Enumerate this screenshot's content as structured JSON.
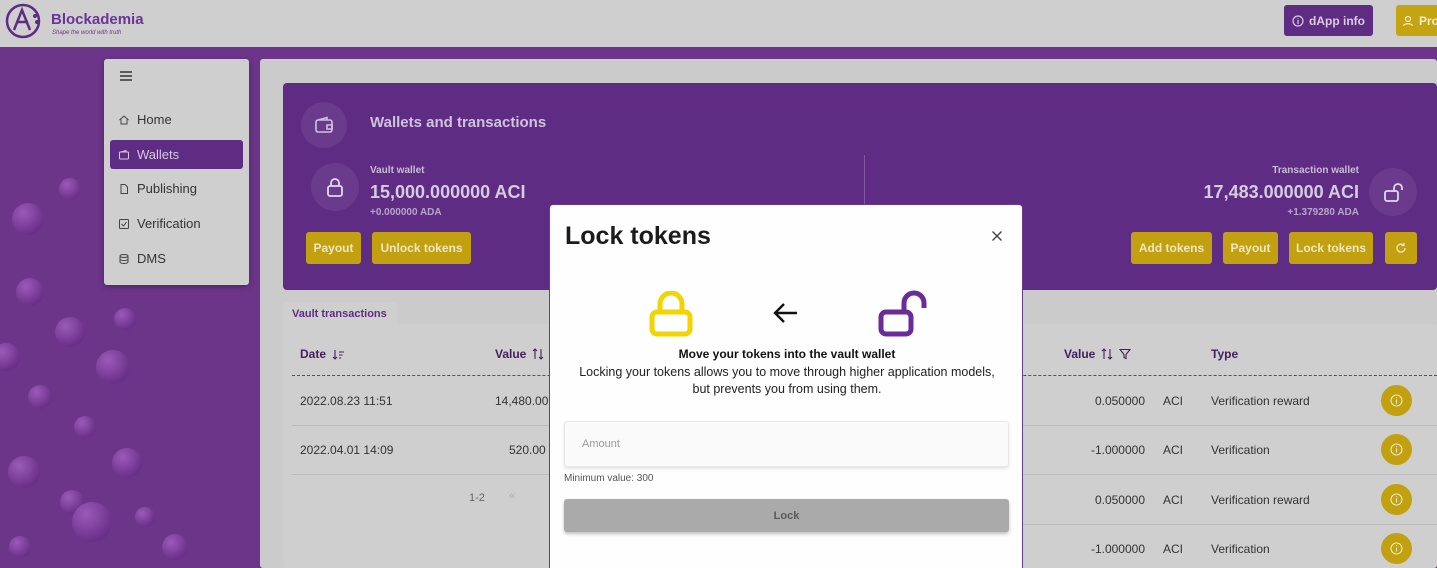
{
  "header": {
    "brand": "Blockademia",
    "tagline": "Shape the world with truth",
    "dapp_info_label": "dApp info",
    "profile_label": "Pro"
  },
  "sidebar": {
    "items": [
      {
        "label": "Home",
        "icon": "home-icon"
      },
      {
        "label": "Wallets",
        "icon": "wallet-icon",
        "active": true
      },
      {
        "label": "Publishing",
        "icon": "document-icon"
      },
      {
        "label": "Verification",
        "icon": "checkbox-icon"
      },
      {
        "label": "DMS",
        "icon": "database-icon"
      }
    ]
  },
  "wallets": {
    "title": "Wallets and transactions",
    "vault": {
      "label": "Vault wallet",
      "value": "15,000.000000 ACI",
      "ada": "+0.000000 ADA",
      "buttons": [
        "Payout",
        "Unlock tokens"
      ]
    },
    "transaction": {
      "label": "Transaction wallet",
      "value": "17,483.000000 ACI",
      "ada": "+1.379280 ADA",
      "buttons": [
        "Add tokens",
        "Payout",
        "Lock tokens"
      ]
    }
  },
  "vault_table": {
    "tab": "Vault transactions",
    "headers": {
      "date": "Date",
      "value": "Value"
    },
    "rows": [
      {
        "date": "2022.08.23 11:51",
        "value": "14,480.00"
      },
      {
        "date": "2022.04.01 14:09",
        "value": "520.00"
      }
    ],
    "pager": {
      "range": "1-2",
      "first": "«"
    }
  },
  "tx_table": {
    "headers": {
      "value": "Value",
      "type": "Type"
    },
    "rows": [
      {
        "value": "0.050000",
        "unit": "ACI",
        "type": "Verification reward"
      },
      {
        "value": "-1.000000",
        "unit": "ACI",
        "type": "Verification"
      },
      {
        "value": "0.050000",
        "unit": "ACI",
        "type": "Verification reward"
      },
      {
        "value": "-1.000000",
        "unit": "ACI",
        "type": "Verification"
      }
    ]
  },
  "modal": {
    "title": "Lock tokens",
    "heading": "Move your tokens into the vault wallet",
    "description_line1": "Locking your tokens allows you to move through higher application models,",
    "description_line2": "but prevents you from using them.",
    "amount_placeholder": "Amount",
    "amount_value": "",
    "min_value_text": "Minimum value: 300",
    "lock_button": "Lock"
  },
  "colors": {
    "primary_purple": "#5e2c82",
    "accent_yellow": "#c1a10f",
    "modal_yellow": "#f2d400",
    "modal_purple": "#6a2c9a"
  }
}
